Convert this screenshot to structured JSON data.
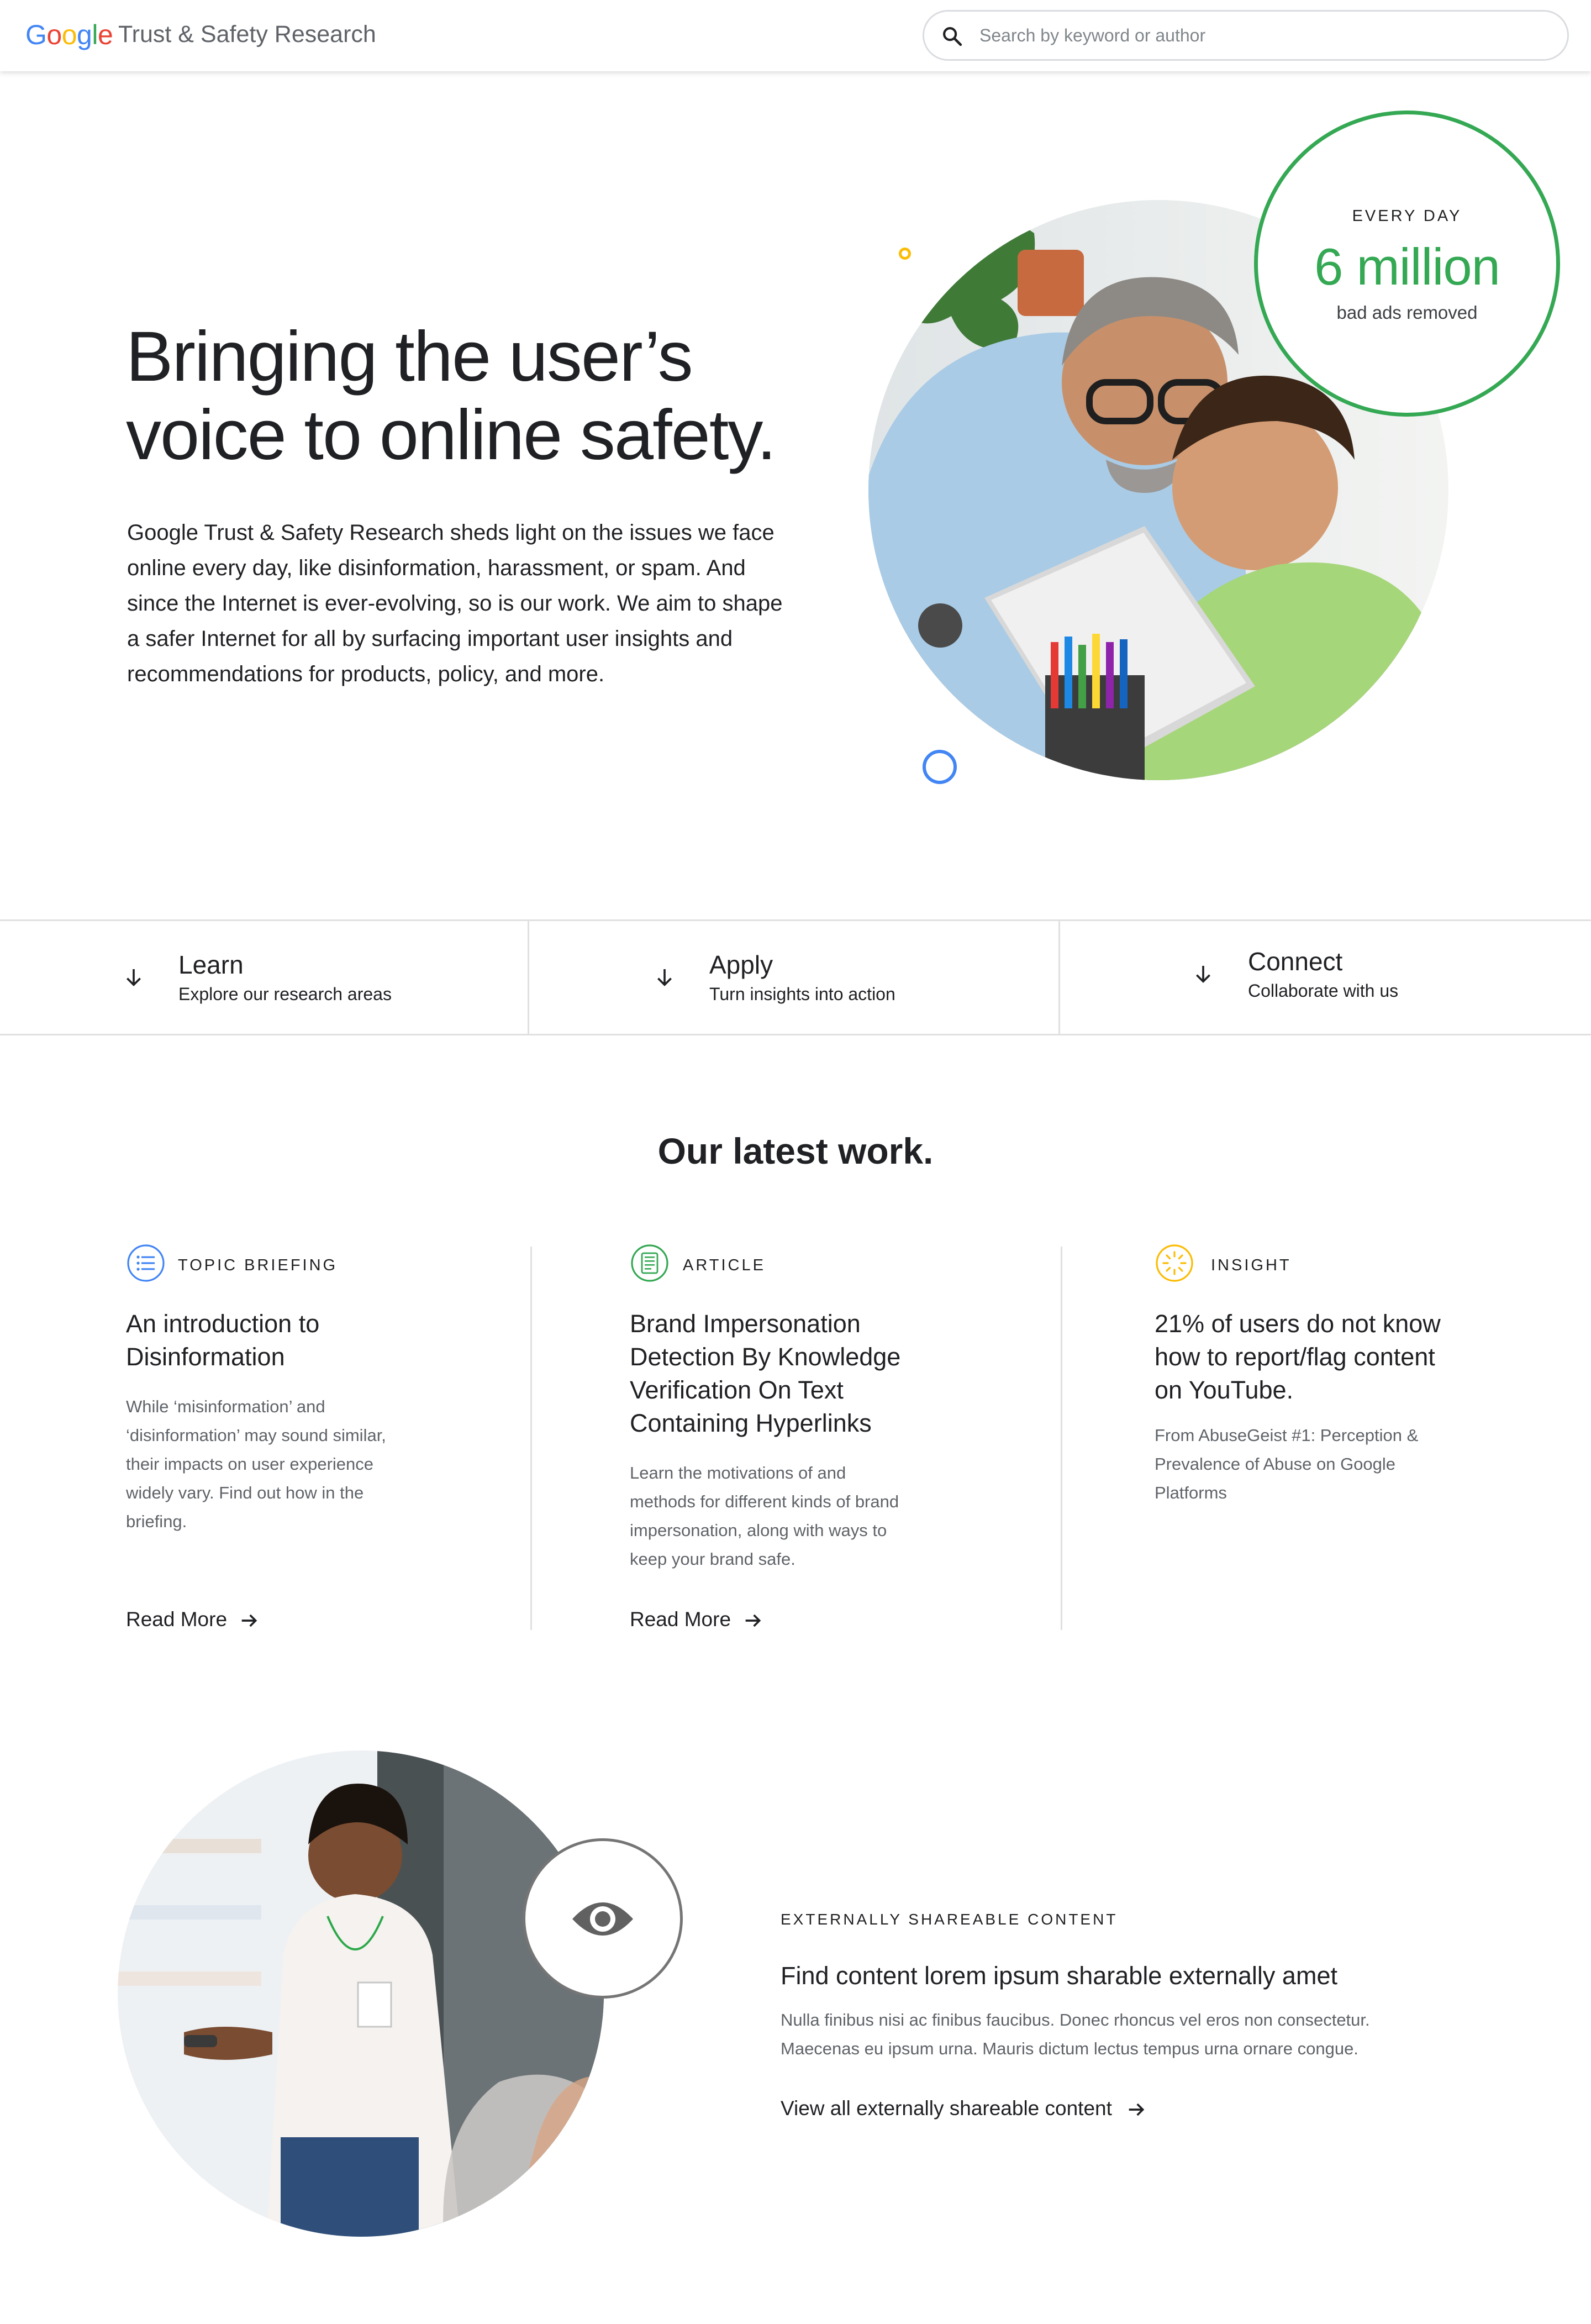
{
  "header": {
    "logo_letters": [
      "G",
      "o",
      "o",
      "g",
      "l",
      "e"
    ],
    "site_title": "Trust & Safety Research",
    "search_placeholder": "Search by keyword or author"
  },
  "hero": {
    "title_lines": [
      "Bringing the user’s",
      "voice to online safety."
    ],
    "body": "Google Trust & Safety Research sheds light on the issues we face online every day, like disinformation, harassment, or spam.  And since the Internet is ever-evolving, so is our work. We aim to shape a safer Internet for all by surfacing important user insights and recommendations for products, policy, and more.",
    "stat": {
      "label": "EVERY DAY",
      "value": "6 million",
      "description": "bad ads removed"
    }
  },
  "nav": [
    {
      "title": "Learn",
      "subtitle": "Explore our research areas",
      "icon": "arrow-down-icon"
    },
    {
      "title": "Apply",
      "subtitle": "Turn insights into action",
      "icon": "arrow-down-icon"
    },
    {
      "title": "Connect",
      "subtitle": "Collaborate with us",
      "icon": "arrow-down-icon"
    }
  ],
  "latest": {
    "title": "Our latest work.",
    "cards": [
      {
        "type": "TOPIC BRIEFING",
        "icon": "list-icon",
        "title_lines": [
          "An introduction to",
          "Disinformation"
        ],
        "desc_lines": [
          "While ‘misinformation’ and",
          "‘disinformation’  may sound similar,",
          "their impacts on user experience",
          "widely vary. Find out how in the",
          "briefing."
        ],
        "link": "Read More"
      },
      {
        "type": "ARTICLE",
        "icon": "article-icon",
        "title_lines": [
          "Brand Impersonation",
          "Detection By Knowledge",
          "Verification On Text",
          "Containing Hyperlinks"
        ],
        "desc_lines": [
          "Learn the motivations of and",
          "methods for different kinds of brand",
          "impersonation, along with ways to",
          "keep your brand safe."
        ],
        "link": "Read More"
      },
      {
        "type": "INSIGHT",
        "icon": "lightbulb-burst-icon",
        "title_lines": [
          "21% of users do not know",
          "how to report/flag content",
          "on YouTube."
        ],
        "desc_lines": [
          "From AbuseGeist #1: Perception &",
          "Prevalence of Abuse on Google",
          "Platforms"
        ],
        "link": ""
      }
    ]
  },
  "shareable": {
    "eyebrow": "EXTERNALLY SHAREABLE CONTENT",
    "title": "Find content lorem ipsum sharable externally amet",
    "text_lines": [
      "Nulla finibus nisi ac finibus faucibus. Donec rhoncus vel eros non consectetur.",
      "Maecenas eu ipsum urna. Mauris dictum lectus tempus urna ornare congue."
    ],
    "link": "View all externally shareable content",
    "icon": "eye-icon"
  },
  "colors": {
    "google_blue": "#4285F4",
    "google_red": "#EA4335",
    "google_yellow": "#FBBC05",
    "google_green": "#34A853",
    "text_primary": "#202124",
    "text_secondary": "#5f6368"
  }
}
